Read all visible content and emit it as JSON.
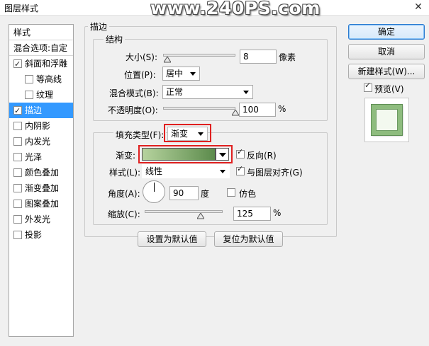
{
  "window": {
    "title": "图层样式",
    "watermark": "www.240PS.com",
    "close_glyph": "✕"
  },
  "nav": {
    "header": "样式",
    "blend_options": "混合选项:自定",
    "items": [
      {
        "label": "斜面和浮雕",
        "checked": true
      },
      {
        "label": "等高线",
        "checked": false
      },
      {
        "label": "纹理",
        "checked": false
      },
      {
        "label": "描边",
        "checked": true
      },
      {
        "label": "内阴影",
        "checked": false
      },
      {
        "label": "内发光",
        "checked": false
      },
      {
        "label": "光泽",
        "checked": false
      },
      {
        "label": "颜色叠加",
        "checked": false
      },
      {
        "label": "渐变叠加",
        "checked": false
      },
      {
        "label": "图案叠加",
        "checked": false
      },
      {
        "label": "外发光",
        "checked": false
      },
      {
        "label": "投影",
        "checked": false
      }
    ]
  },
  "stroke": {
    "group_title": "描边",
    "structure": {
      "title": "结构",
      "size_label": "大小(S):",
      "size_value": "8",
      "size_unit": "像素",
      "position_label": "位置(P):",
      "position_value": "居中",
      "blend_label": "混合模式(B):",
      "blend_value": "正常",
      "opacity_label": "不透明度(O):",
      "opacity_value": "100",
      "opacity_unit": "%"
    },
    "fill": {
      "type_label": "填充类型(F):",
      "type_value": "渐变",
      "gradient_label": "渐变:",
      "reverse_label": "反向(R)",
      "reverse_checked": true,
      "style_label": "样式(L):",
      "style_value": "线性",
      "align_label": "与图层对齐(G)",
      "align_checked": true,
      "angle_label": "角度(A):",
      "angle_value": "90",
      "angle_unit": "度",
      "dither_label": "仿色",
      "dither_checked": false,
      "scale_label": "缩放(C):",
      "scale_value": "125",
      "scale_unit": "%"
    },
    "set_default": "设置为默认值",
    "reset_default": "复位为默认值"
  },
  "actions": {
    "ok": "确定",
    "cancel": "取消",
    "new_style": "新建样式(W)...",
    "preview_label": "预览(V)",
    "preview_checked": true
  },
  "values": {
    "size_fraction": 0.06,
    "opacity_fraction": 1.0,
    "scale_fraction": 0.72
  },
  "colors": {
    "gradient_start": "#b6d39e",
    "gradient_end": "#5c8b4c",
    "selection": "#3399ff",
    "highlight_box": "#e02020"
  }
}
